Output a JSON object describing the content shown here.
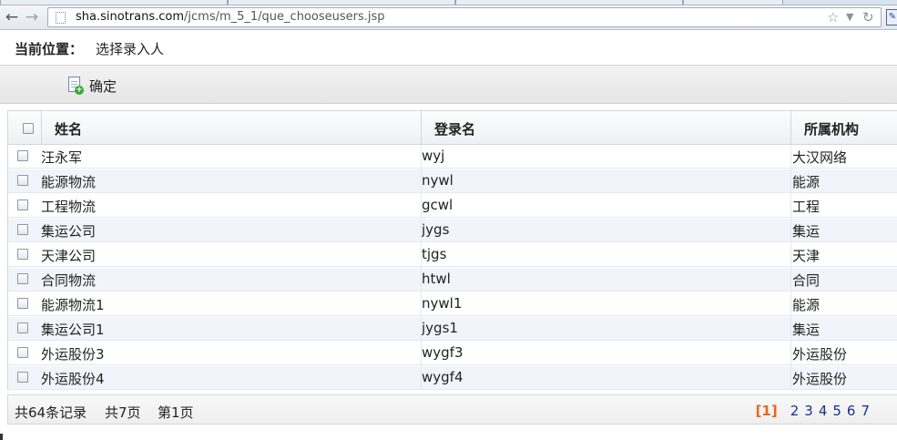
{
  "browser": {
    "url_host": "sha.sinotrans.com",
    "url_path": "/jcms/m_5_1/que_chooseusers.jsp",
    "back_icon": "back-arrow-icon",
    "forward_icon": "forward-arrow-icon",
    "star_icon": "star-icon",
    "reload_icon": "reload-icon"
  },
  "location": {
    "label": "当前位置：",
    "value": "选择录入人"
  },
  "actions": {
    "confirm_label": "确定",
    "confirm_icon": "add-document-icon"
  },
  "table": {
    "columns": [
      "姓名",
      "登录名",
      "所属机构"
    ],
    "rows": [
      {
        "name": "汪永军",
        "login": "wyj",
        "org": "大汉网络"
      },
      {
        "name": "能源物流",
        "login": "nywl",
        "org": "能源"
      },
      {
        "name": "工程物流",
        "login": "gcwl",
        "org": "工程"
      },
      {
        "name": "集运公司",
        "login": "jygs",
        "org": "集运"
      },
      {
        "name": "天津公司",
        "login": "tjgs",
        "org": "天津"
      },
      {
        "name": "合同物流",
        "login": "htwl",
        "org": "合同"
      },
      {
        "name": "能源物流1",
        "login": "nywl1",
        "org": "能源"
      },
      {
        "name": "集运公司1",
        "login": "jygs1",
        "org": "集运"
      },
      {
        "name": "外运股份3",
        "login": "wygf3",
        "org": "外运股份"
      },
      {
        "name": "外运股份4",
        "login": "wygf4",
        "org": "外运股份"
      }
    ]
  },
  "pager": {
    "total_records": "共64条记录",
    "total_pages": "共7页",
    "current_page": "第1页",
    "current_marker": "[1]",
    "pages": [
      "2",
      "3",
      "4",
      "5",
      "6",
      "7"
    ]
  },
  "colors": {
    "current_page": "#e8671c",
    "page_link": "#1b2f8f",
    "row_stripe": "#f1f5fb"
  }
}
